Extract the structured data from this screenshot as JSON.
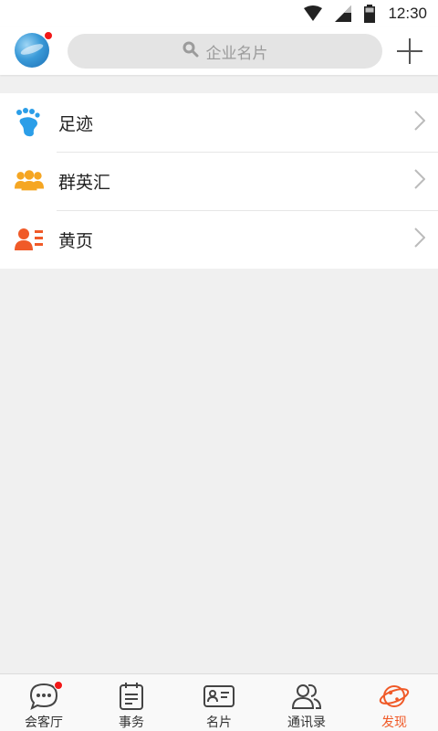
{
  "status_bar": {
    "time": "12:30",
    "icons": [
      "wifi-icon",
      "signal-icon",
      "battery-icon"
    ]
  },
  "header": {
    "avatar_badge": true,
    "search_placeholder": "企业名片",
    "add_icon": "plus-icon"
  },
  "menu": {
    "items": [
      {
        "label": "足迹",
        "icon": "footprint-icon",
        "color": "#2b9ee8"
      },
      {
        "label": "群英汇",
        "icon": "group-icon",
        "color": "#f5a623"
      },
      {
        "label": "黄页",
        "icon": "yellow-pages-icon",
        "color": "#f05a28"
      }
    ]
  },
  "tabs": [
    {
      "label": "会客厅",
      "icon": "chat-bubble-icon",
      "badge": true,
      "active": false
    },
    {
      "label": "事务",
      "icon": "notepad-icon",
      "badge": false,
      "active": false
    },
    {
      "label": "名片",
      "icon": "card-icon",
      "badge": false,
      "active": false
    },
    {
      "label": "通讯录",
      "icon": "contacts-icon",
      "badge": false,
      "active": false
    },
    {
      "label": "发现",
      "icon": "planet-icon",
      "badge": false,
      "active": true
    }
  ],
  "colors": {
    "accent": "#f05a28",
    "badge": "#f21818",
    "background": "#f0f0f0"
  }
}
